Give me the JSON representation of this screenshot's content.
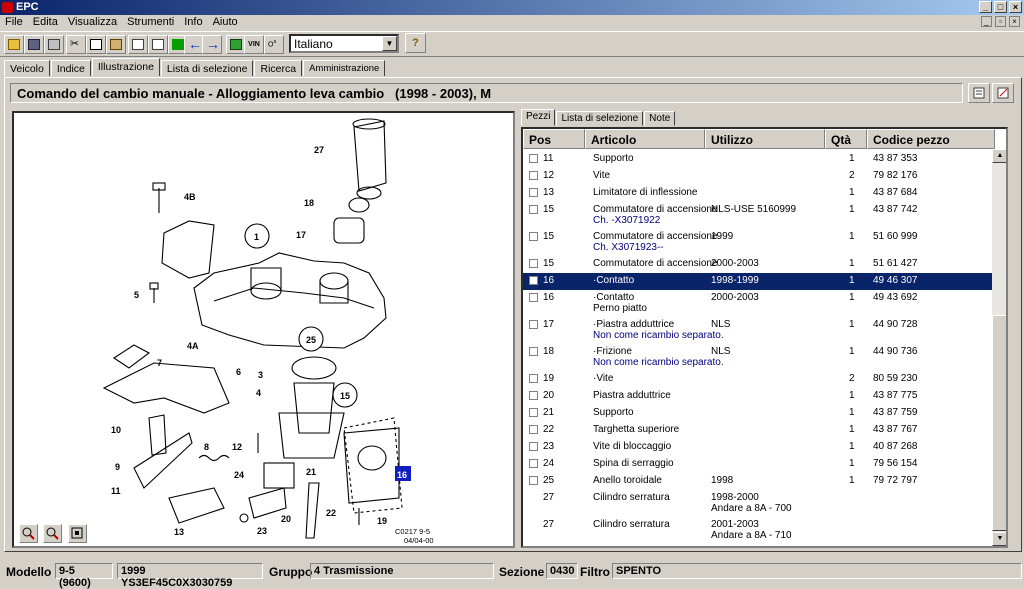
{
  "window": {
    "title": "EPC"
  },
  "menu": [
    "File",
    "Edita",
    "Visualizza",
    "Strumenti",
    "Info",
    "Aiuto"
  ],
  "toolbar": {
    "language": "Italiano",
    "vin_label": "VIN",
    "help_label": "?"
  },
  "tabs": [
    "Veicolo",
    "Indice",
    "Illustrazione",
    "Lista di selezione",
    "Ricerca",
    "Amministrazione"
  ],
  "header": {
    "title": "Comando del cambio manuale - Alloggiamento leva cambio   (1998 - 2003), M"
  },
  "illustration": {
    "code": "C0217 9-5",
    "date": "04/04-00",
    "callouts": [
      "27",
      "18",
      "17",
      "4B",
      "1",
      "5",
      "4A",
      "7",
      "6",
      "3",
      "4",
      "25",
      "15",
      "10",
      "8",
      "12",
      "9",
      "24",
      "21",
      "11",
      "16",
      "13",
      "20",
      "22",
      "23",
      "19"
    ],
    "highlight": "16"
  },
  "subtabs": [
    "Pezzi",
    "Lista di selezione",
    "Note"
  ],
  "columns": [
    "Pos",
    "Articolo",
    "Utilizzo",
    "Qtà",
    "Codice pezzo"
  ],
  "rows": [
    {
      "pos": "11",
      "art": "Supporto",
      "art2": "",
      "uso": "",
      "uso2": "",
      "qty": "1",
      "code": "43 87 353",
      "cb": true,
      "sel": false
    },
    {
      "pos": "12",
      "art": "Vite",
      "art2": "",
      "uso": "",
      "uso2": "",
      "qty": "2",
      "code": "79 82 176",
      "cb": true,
      "sel": false
    },
    {
      "pos": "13",
      "art": "Limitatore di inflessione",
      "art2": "",
      "uso": "",
      "uso2": "",
      "qty": "1",
      "code": "43 87 684",
      "cb": true,
      "sel": false
    },
    {
      "pos": "15",
      "art": "Commutatore di accensione",
      "art2": "Ch. -X3071922",
      "uso": "NLS-USE 5160999",
      "uso2": "",
      "qty": "1",
      "code": "43 87 742",
      "cb": true,
      "sel": false
    },
    {
      "pos": "15",
      "art": "Commutatore di accensione",
      "art2": "Ch. X3071923--",
      "uso": "1999",
      "uso2": "",
      "qty": "1",
      "code": "51 60 999",
      "cb": true,
      "sel": false
    },
    {
      "pos": "15",
      "art": "Commutatore di accensione",
      "art2": "",
      "uso": "2000-2003",
      "uso2": "",
      "qty": "1",
      "code": "51 61 427",
      "cb": true,
      "sel": false
    },
    {
      "pos": "16",
      "art": "·Contatto",
      "art2": "",
      "uso": "1998-1999",
      "uso2": "",
      "qty": "1",
      "code": "49 46 307",
      "cb": true,
      "sel": true
    },
    {
      "pos": "16",
      "art": "·Contatto",
      "art2": "Perno piatto",
      "uso": "2000-2003",
      "uso2": "",
      "qty": "1",
      "code": "49 43 692",
      "cb": true,
      "sel": false
    },
    {
      "pos": "17",
      "art": "·Piastra adduttrice",
      "art2": "Non come ricambio separato.",
      "uso": "NLS",
      "uso2": "",
      "qty": "1",
      "code": "44 90 728",
      "cb": true,
      "sel": false
    },
    {
      "pos": "18",
      "art": "·Frizione",
      "art2": "Non come ricambio separato.",
      "uso": "NLS",
      "uso2": "",
      "qty": "1",
      "code": "44 90 736",
      "cb": true,
      "sel": false
    },
    {
      "pos": "19",
      "art": "·Vite",
      "art2": "",
      "uso": "",
      "uso2": "",
      "qty": "2",
      "code": "80 59 230",
      "cb": true,
      "sel": false
    },
    {
      "pos": "20",
      "art": "Piastra adduttrice",
      "art2": "",
      "uso": "",
      "uso2": "",
      "qty": "1",
      "code": "43 87 775",
      "cb": true,
      "sel": false
    },
    {
      "pos": "21",
      "art": "Supporto",
      "art2": "",
      "uso": "",
      "uso2": "",
      "qty": "1",
      "code": "43 87 759",
      "cb": true,
      "sel": false
    },
    {
      "pos": "22",
      "art": "Targhetta superiore",
      "art2": "",
      "uso": "",
      "uso2": "",
      "qty": "1",
      "code": "43 87 767",
      "cb": true,
      "sel": false
    },
    {
      "pos": "23",
      "art": "Vite di bloccaggio",
      "art2": "",
      "uso": "",
      "uso2": "",
      "qty": "1",
      "code": "40 87 268",
      "cb": true,
      "sel": false
    },
    {
      "pos": "24",
      "art": "Spina di serraggio",
      "art2": "",
      "uso": "",
      "uso2": "",
      "qty": "1",
      "code": "79 56 154",
      "cb": true,
      "sel": false
    },
    {
      "pos": "25",
      "art": "Anello toroidale",
      "art2": "",
      "uso": "1998",
      "uso2": "",
      "qty": "1",
      "code": "79 72 797",
      "cb": true,
      "sel": false
    },
    {
      "pos": "27",
      "art": "Cilindro serratura",
      "art2": "",
      "uso": "1998-2000",
      "uso2": "Andare a 8A - 700",
      "qty": "",
      "code": "",
      "cb": false,
      "sel": false
    },
    {
      "pos": "27",
      "art": "Cilindro serratura",
      "art2": "",
      "uso": "2001-2003",
      "uso2": "Andare a 8A - 710",
      "qty": "",
      "code": "",
      "cb": false,
      "sel": false
    }
  ],
  "status": {
    "modello_label": "Modello",
    "modello": "9-5 (9600)",
    "vin": "1999 YS3EF45C0X3030759",
    "gruppo_label": "Gruppo",
    "gruppo": "4 Trasmissione",
    "sezione_label": "Sezione",
    "sezione": "0430",
    "filtro_label": "Filtro",
    "filtro": "SPENTO"
  },
  "colors": {
    "selection": "#0a246a",
    "note": "#000080",
    "highlight": "#1020c0"
  }
}
